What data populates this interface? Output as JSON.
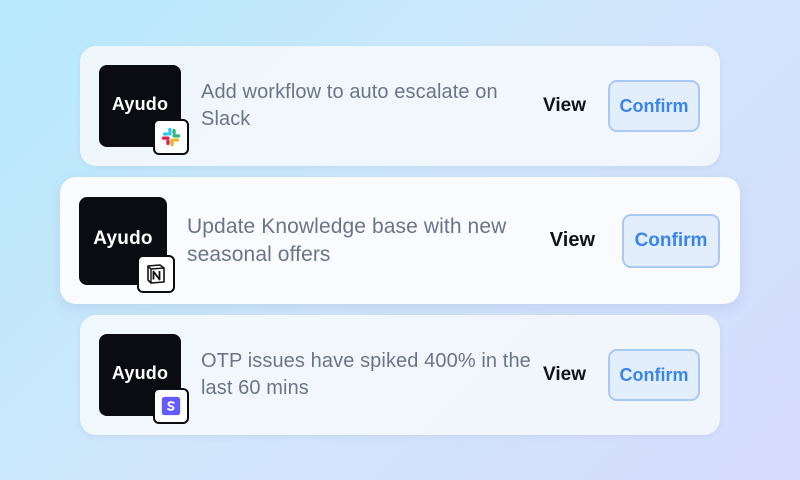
{
  "colors": {
    "background_start": "#b5e9fb",
    "background_end": "#d7dcfd",
    "logo_bg": "#0b0b12",
    "message_text": "#6b7588",
    "confirm_text": "#3a86e8",
    "confirm_bg": "#e3eefd"
  },
  "cards": [
    {
      "logo_text": "Ayudo",
      "badge_icon": "slack-icon",
      "message": "Add workflow to auto escalate on Slack",
      "view_label": "View",
      "confirm_label": "Confirm"
    },
    {
      "logo_text": "Ayudo",
      "badge_icon": "notion-icon",
      "message": "Update Knowledge base with new seasonal offers",
      "view_label": "View",
      "confirm_label": "Confirm"
    },
    {
      "logo_text": "Ayudo",
      "badge_icon": "stripe-icon",
      "message": "OTP issues have spiked 400% in the last 60 mins",
      "view_label": "View",
      "confirm_label": "Confirm"
    }
  ]
}
